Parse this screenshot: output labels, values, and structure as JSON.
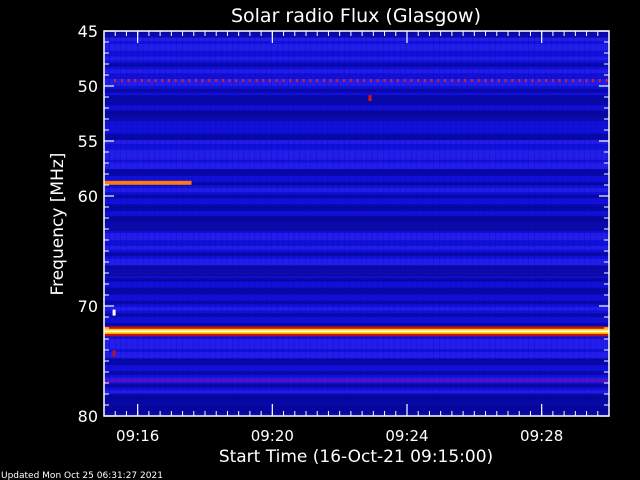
{
  "chart_data": {
    "type": "heatmap",
    "title": "Solar radio Flux (Glasgow)",
    "xlabel": "Start Time (16-Oct-21 09:15:00)",
    "ylabel": "Frequency [MHz]",
    "footer": "Updated Mon Oct 25 06:31:27 2021",
    "x_range_minutes": [
      0,
      15
    ],
    "x_ticks": [
      {
        "label": "09:16",
        "minute": 1
      },
      {
        "label": "09:20",
        "minute": 5
      },
      {
        "label": "09:24",
        "minute": 9
      },
      {
        "label": "09:28",
        "minute": 13
      }
    ],
    "ylim": [
      45,
      80
    ],
    "y_ticks": [
      45,
      50,
      55,
      60,
      70,
      80
    ],
    "bands": [
      {
        "freq_mhz": 49.5,
        "intensity": "medium",
        "pattern": "dotted",
        "start_min": 0.3,
        "end_min": 14.9,
        "color": "#d02040"
      },
      {
        "freq_mhz": 58.8,
        "intensity": "high",
        "pattern": "solid",
        "start_min": 0.0,
        "end_min": 2.6,
        "color": "#ff7a10"
      },
      {
        "freq_mhz": 72.3,
        "intensity": "very-high",
        "pattern": "solid",
        "start_min": 0.0,
        "end_min": 15.0,
        "color": "#ffd200"
      },
      {
        "freq_mhz": 76.8,
        "intensity": "low",
        "pattern": "solid",
        "start_min": 0.0,
        "end_min": 15.0,
        "color": "#5a10b8"
      }
    ],
    "spots": [
      {
        "freq_mhz": 51.1,
        "minute": 7.9,
        "color": "#e01010"
      },
      {
        "freq_mhz": 70.6,
        "minute": 0.3,
        "color": "#ffffff"
      },
      {
        "freq_mhz": 74.3,
        "minute": 0.3,
        "color": "#c01020"
      }
    ],
    "colors": {
      "background": "#1010d8",
      "dark_band": "#06069a",
      "light_band": "#2a22f0",
      "frame": "#ffffff",
      "page": "#000000"
    }
  }
}
